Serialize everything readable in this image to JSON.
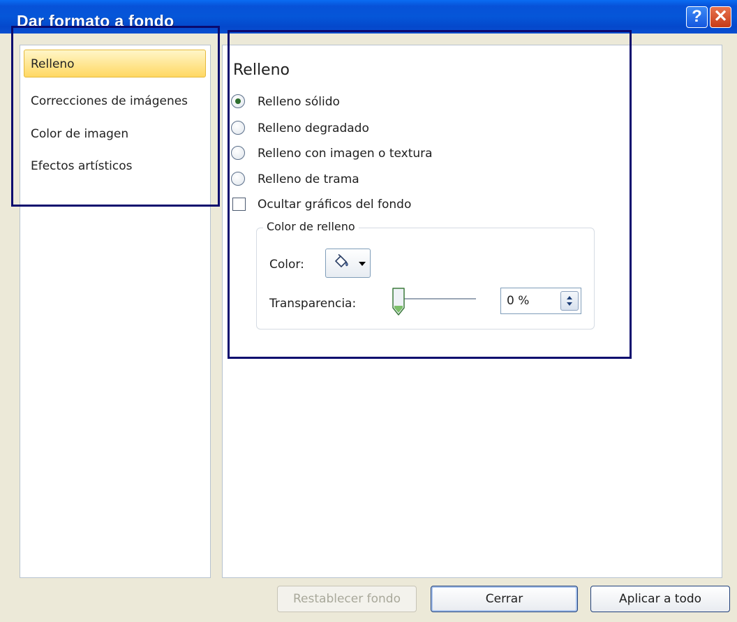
{
  "window": {
    "title": "Dar formato a fondo",
    "help_glyph": "?",
    "close_glyph": "✕"
  },
  "sidebar": {
    "items": [
      {
        "label": "Relleno",
        "selected": true
      },
      {
        "label": "Correcciones de imágenes",
        "selected": false
      },
      {
        "label": "Color de imagen",
        "selected": false
      },
      {
        "label": "Efectos artísticos",
        "selected": false
      }
    ]
  },
  "fill": {
    "section_title": "Relleno",
    "options": [
      {
        "label": "Relleno sólido",
        "checked": true
      },
      {
        "label": "Relleno degradado",
        "checked": false
      },
      {
        "label": "Relleno con imagen o textura",
        "checked": false
      },
      {
        "label": "Relleno de trama",
        "checked": false
      }
    ],
    "hide_background_graphics": {
      "label": "Ocultar gráficos del fondo",
      "checked": false
    },
    "fill_color": {
      "legend": "Color de relleno",
      "color_label": "Color:",
      "color_icon": "paint-bucket-icon",
      "transparency_label": "Transparencia:",
      "transparency_value": "0 %",
      "transparency_percent": 0
    }
  },
  "buttons": {
    "reset": {
      "label": "Restablecer fondo",
      "enabled": false
    },
    "close": {
      "label": "Cerrar"
    },
    "apply_all": {
      "label": "Aplicar a todo"
    }
  },
  "colors": {
    "title_bar": "#0752d8",
    "selected_item": "#ffd863",
    "annotation_box": "#0a0a6e"
  }
}
